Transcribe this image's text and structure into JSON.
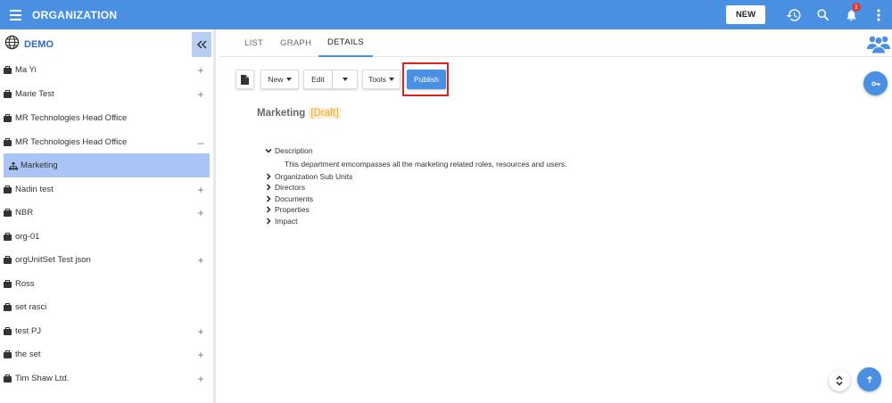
{
  "header": {
    "title": "ORGANIZATION",
    "new_label": "NEW",
    "notification_count": "1",
    "icons": [
      "menu-icon",
      "history-icon",
      "search-icon",
      "bell-icon",
      "more-vert-icon"
    ]
  },
  "sidebar": {
    "title": "DEMO",
    "items": [
      {
        "label": "Ma Yi",
        "toggle": "+"
      },
      {
        "label": "Marie Test",
        "toggle": "+"
      },
      {
        "label": "MR Technologies Head Office",
        "toggle": ""
      },
      {
        "label": "MR Technologies Head Office",
        "toggle": "–"
      },
      {
        "label": "Marketing",
        "toggle": ""
      },
      {
        "label": "Nadin test",
        "toggle": "+"
      },
      {
        "label": "NBR",
        "toggle": "+"
      },
      {
        "label": "org-01",
        "toggle": ""
      },
      {
        "label": "orgUnitSet Test json",
        "toggle": "+"
      },
      {
        "label": "Ross",
        "toggle": ""
      },
      {
        "label": "set rasci",
        "toggle": ""
      },
      {
        "label": "test PJ",
        "toggle": "+"
      },
      {
        "label": "the set",
        "toggle": "+"
      },
      {
        "label": "Tim Shaw Ltd.",
        "toggle": "+"
      }
    ]
  },
  "tabs": [
    {
      "label": "LIST"
    },
    {
      "label": "GRAPH"
    },
    {
      "label": "DETAILS"
    }
  ],
  "toolbar": {
    "new_label": "New",
    "edit_label": "Edit",
    "tools_label": "Tools",
    "publish_label": "Publish"
  },
  "entity": {
    "name": "Marketing",
    "status": "[Draft]"
  },
  "sections": {
    "description": {
      "label": "Description",
      "text": "This department emcompasses all the marketing related roles, resources and users."
    },
    "org_sub_units": "Organization Sub Units",
    "directors": "Directors",
    "documents": "Documents",
    "properties": "Properties",
    "impact": "Impact"
  },
  "colors": {
    "primary": "#4a90e2",
    "selected_row": "#a9c4f5",
    "draft": "#f5a623",
    "highlight_box": "#e02020"
  }
}
